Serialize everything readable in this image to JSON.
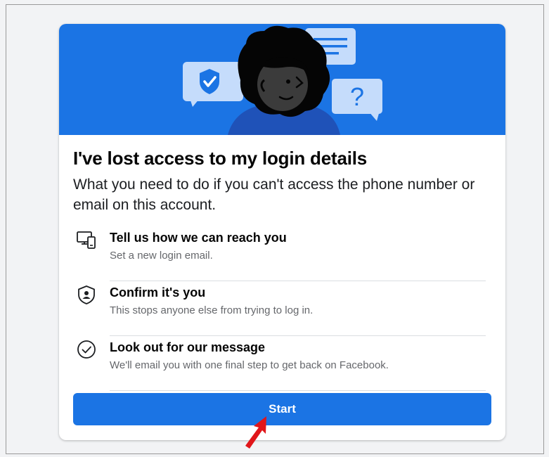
{
  "page": {
    "title": "I've lost access to my login details",
    "subtitle": "What you need to do if you can't access the phone number or email on this account."
  },
  "steps": [
    {
      "icon": "devices-icon",
      "title": "Tell us how we can reach you",
      "description": "Set a new login email."
    },
    {
      "icon": "shield-person-icon",
      "title": "Confirm it's you",
      "description": "This stops anyone else from trying to log in."
    },
    {
      "icon": "check-circle-icon",
      "title": "Look out for our message",
      "description": "We'll email you with one final step to get back on Facebook."
    }
  ],
  "hero_question_mark": "?",
  "start_button": {
    "label": "Start"
  },
  "colors": {
    "brand_blue": "#1b74e4",
    "bubble_light_blue": "#c5dcfb",
    "annotation_red": "#e0161a"
  }
}
